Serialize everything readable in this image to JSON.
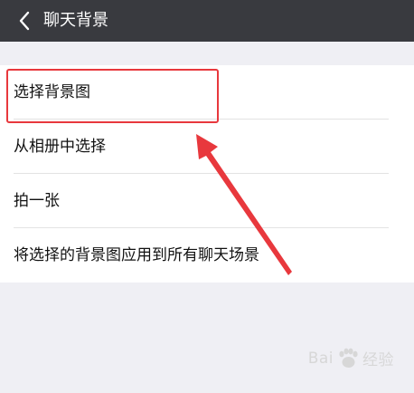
{
  "header": {
    "back_icon": "chevron-left-icon",
    "title": "聊天背景"
  },
  "options": [
    {
      "label": "选择背景图"
    },
    {
      "label": "从相册中选择"
    },
    {
      "label": "拍一张"
    },
    {
      "label": "将选择的背景图应用到所有聊天场景"
    }
  ],
  "annotation": {
    "color": "#e8383d"
  },
  "watermark": {
    "brand_left": "Bai",
    "brand_right": "经验"
  },
  "colors": {
    "header_bg": "#393a3f",
    "page_bg": "#efeff4",
    "list_bg": "#ffffff"
  }
}
